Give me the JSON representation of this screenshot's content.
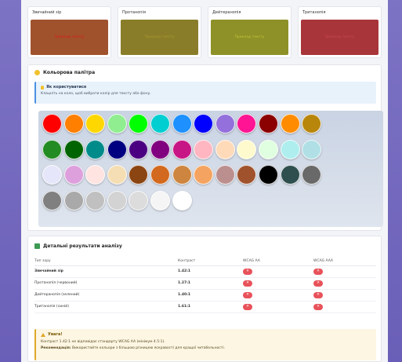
{
  "previews": [
    {
      "label": "Звичайний зір",
      "bg": "#a0522d",
      "fg": "#d81b1b",
      "sample": "Приклад тексту"
    },
    {
      "label": "Протанопія",
      "bg": "#8a7d2a",
      "fg": "#a89a2c",
      "sample": "Приклад тексту"
    },
    {
      "label": "Дейтеранопія",
      "bg": "#8d9127",
      "fg": "#c7c23a",
      "sample": "Приклад тексту"
    },
    {
      "label": "Тританопія",
      "bg": "#a8353a",
      "fg": "#c94a4f",
      "sample": "Приклад тексту"
    }
  ],
  "palette": {
    "title": "Кольорова палітра",
    "hint_title": "Як користуватися",
    "hint_text": "Клацніть на коло, щоб вибрати колір для тексту або фону.",
    "swatches": [
      "#ff0000",
      "#ff7f00",
      "#ffd700",
      "#90ee90",
      "#00ff00",
      "#00ced1",
      "#1e90ff",
      "#0000ff",
      "#9370db",
      "#ff1493",
      "#8b0000",
      "#ff8c00",
      "#b8860b",
      "#228b22",
      "#006400",
      "#008b8b",
      "#000080",
      "#4b0082",
      "#800080",
      "#c71585",
      "#ffb6c1",
      "#ffdab9",
      "#fffacd",
      "#e0ffe0",
      "#afeeee",
      "#b0e0e6",
      "#e6e6fa",
      "#dda0dd",
      "#ffe4e1",
      "#f5deb3",
      "#8b4513",
      "#d2691e",
      "#cd853f",
      "#f4a460",
      "#bc8f8f",
      "#a0522d",
      "#000000",
      "#2f4f4f",
      "#696969",
      "#808080",
      "#a9a9a9",
      "#c0c0c0",
      "#d3d3d3",
      "#dcdcdc",
      "#f5f5f5",
      "#ffffff"
    ]
  },
  "results": {
    "title": "Детальні результати аналізу",
    "headers": [
      "Тип зору",
      "Контраст",
      "WCAG AA",
      "WCAG AAA"
    ],
    "rows": [
      {
        "name": "Звичайний зір",
        "contrast": "1.42:1",
        "aa": "✕",
        "aaa": "✕"
      },
      {
        "name": "Протанопія (червоний)",
        "contrast": "1.27:1",
        "aa": "✕",
        "aaa": "✕"
      },
      {
        "name": "Дейтеранопія (зелений)",
        "contrast": "1.40:1",
        "aa": "✕",
        "aaa": "✕"
      },
      {
        "name": "Тританопія (синій)",
        "contrast": "1.61:1",
        "aa": "✕",
        "aaa": "✕"
      }
    ],
    "warning_title": "Увага!",
    "warning_text": "Контраст 1.42:1 не відповідає стандарту WCAG AA (мінімум 4.5:1).",
    "rec_label": "Рекомендація:",
    "rec_text": "Використайте кольори з більшою різницею яскравості для кращої читабельності."
  },
  "colors": {
    "frame": "#7d73c4",
    "fail": "#e8525a",
    "palette_icon": "#f2c12e"
  }
}
